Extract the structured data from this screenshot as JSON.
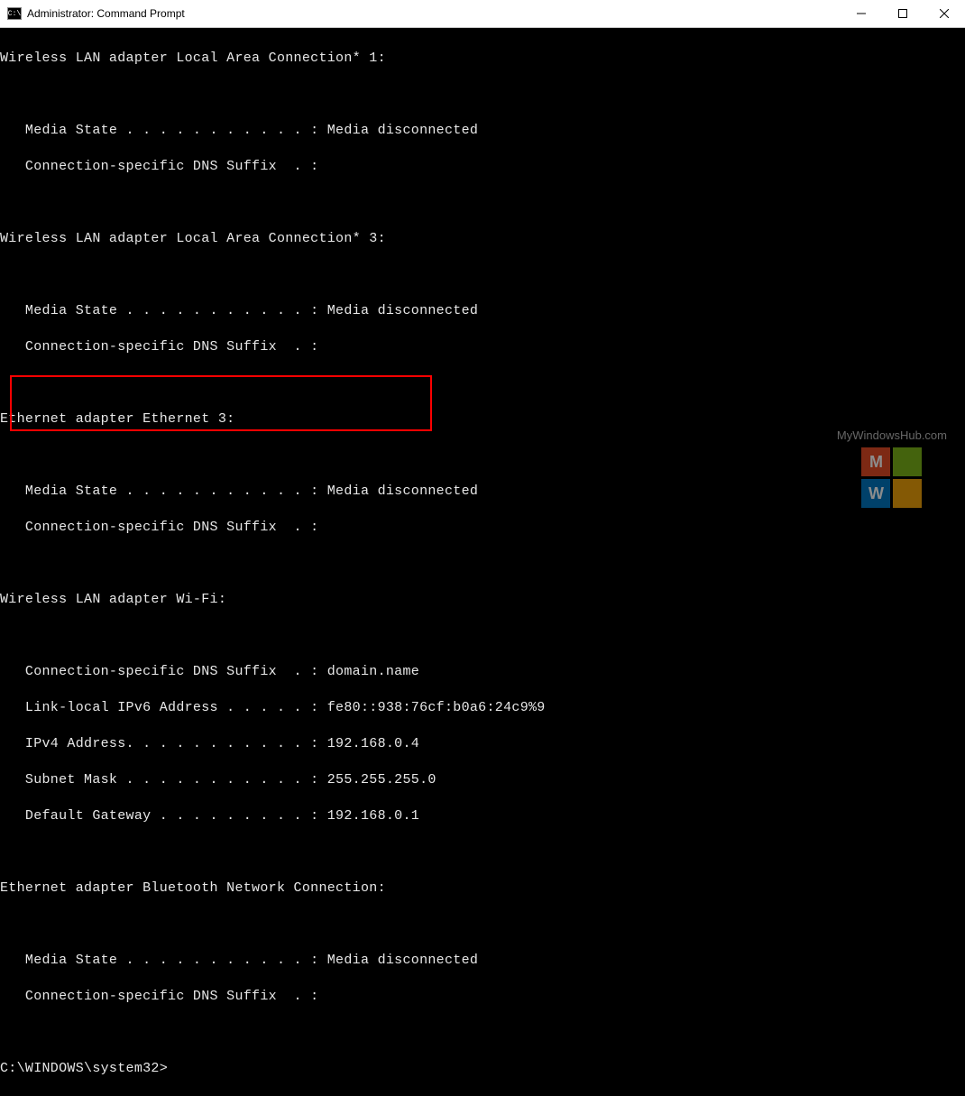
{
  "titlebar": {
    "icon_label": "C:\\",
    "title": "Administrator: Command Prompt"
  },
  "terminal": {
    "sections": [
      {
        "header": "Wireless LAN adapter Local Area Connection* 1:",
        "lines": [
          "   Media State . . . . . . . . . . . : Media disconnected",
          "   Connection-specific DNS Suffix  . :"
        ]
      },
      {
        "header": "Wireless LAN adapter Local Area Connection* 3:",
        "lines": [
          "   Media State . . . . . . . . . . . : Media disconnected",
          "   Connection-specific DNS Suffix  . :"
        ]
      },
      {
        "header": "Ethernet adapter Ethernet 3:",
        "lines": [
          "   Media State . . . . . . . . . . . : Media disconnected",
          "   Connection-specific DNS Suffix  . :"
        ]
      },
      {
        "header": "Wireless LAN adapter Wi-Fi:",
        "lines": [
          "   Connection-specific DNS Suffix  . : domain.name",
          "   Link-local IPv6 Address . . . . . : fe80::938:76cf:b0a6:24c9%9",
          "   IPv4 Address. . . . . . . . . . . : 192.168.0.4",
          "   Subnet Mask . . . . . . . . . . . : 255.255.255.0",
          "   Default Gateway . . . . . . . . . : 192.168.0.1"
        ]
      },
      {
        "header": "Ethernet adapter Bluetooth Network Connection:",
        "lines": [
          "   Media State . . . . . . . . . . . : Media disconnected",
          "   Connection-specific DNS Suffix  . :"
        ]
      }
    ],
    "prompt": "C:\\WINDOWS\\system32>"
  },
  "watermark": {
    "text": "MyWindowsHub.com",
    "letters": {
      "m": "M",
      "w": "W"
    }
  }
}
